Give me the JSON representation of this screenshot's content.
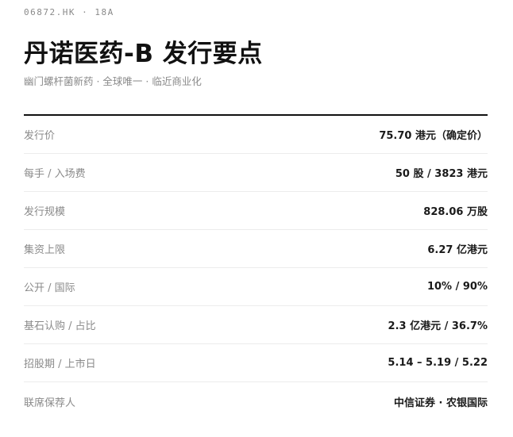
{
  "header": {
    "code": "06872.HK",
    "separator": "·",
    "tag": "18A",
    "title": "丹诺医药-B 发行要点",
    "subtitle": "幽门螺杆菌新药 · 全球唯一 · 临近商业化"
  },
  "rows": [
    {
      "label": "发行价",
      "value": "75.70 港元（确定价）"
    },
    {
      "label": "每手 / 入场费",
      "value": "50 股 / 3823 港元"
    },
    {
      "label": "发行规模",
      "value": "828.06 万股"
    },
    {
      "label": "集资上限",
      "value": "6.27 亿港元"
    },
    {
      "label": "公开 / 国际",
      "value": "10% / 90%"
    },
    {
      "label": "基石认购 / 占比",
      "value": "2.3 亿港元 / 36.7%"
    },
    {
      "label": "招股期 / 上市日",
      "value": "5.14 – 5.19 / 5.22"
    },
    {
      "label": "联席保荐人",
      "value": "中信证券 · 农银国际"
    }
  ]
}
